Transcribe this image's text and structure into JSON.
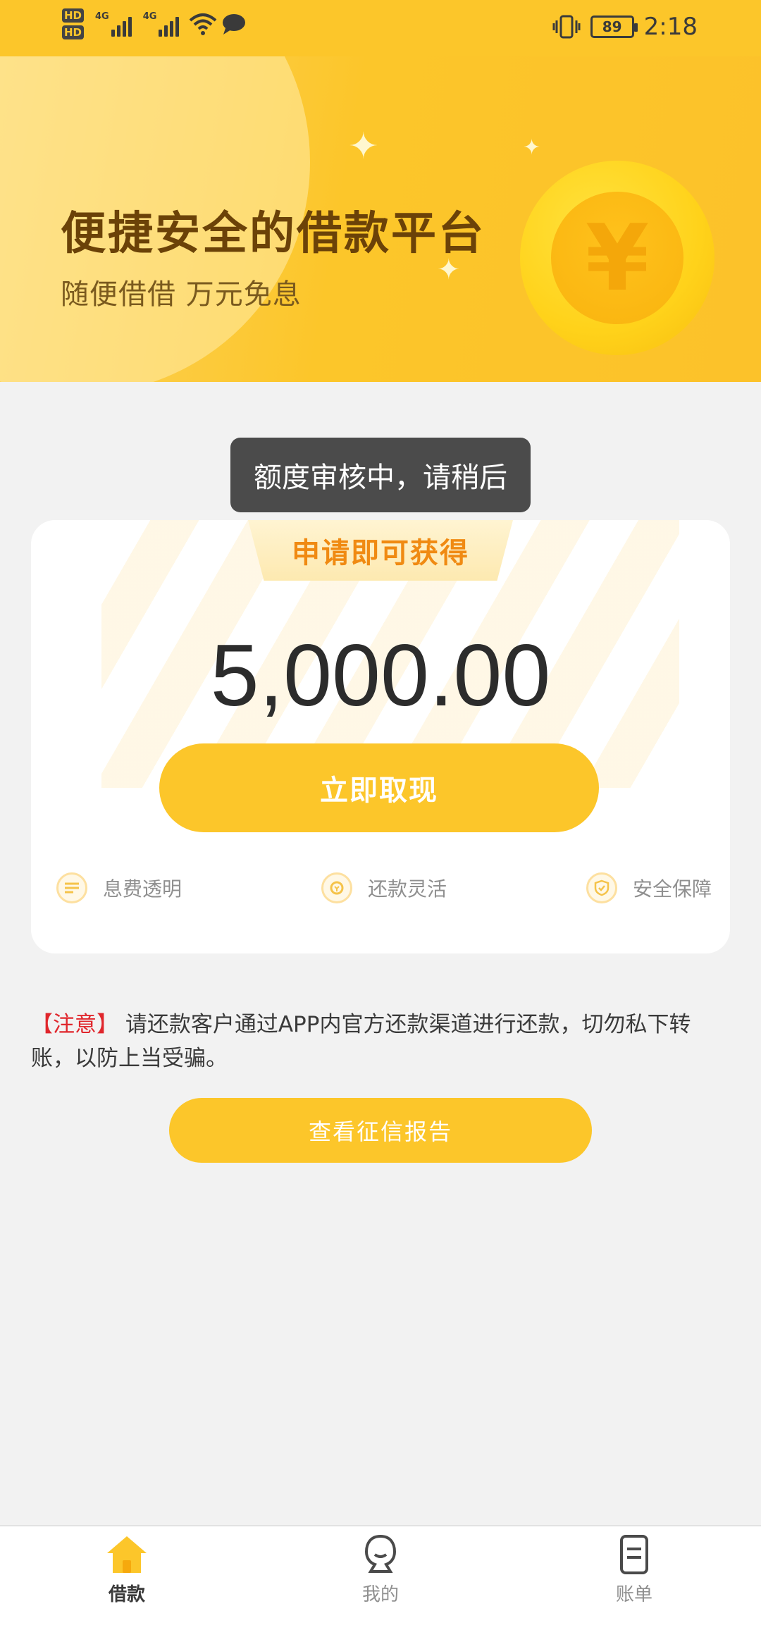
{
  "status_bar": {
    "hd1": "HD",
    "hd2": "HD",
    "sim1_label": "4G",
    "sim2_label": "4G",
    "battery": "89",
    "time": "2:18"
  },
  "banner": {
    "title": "便捷安全的借款平台",
    "subtitle": "随便借借 万元免息",
    "coin_symbol": "¥"
  },
  "toast": {
    "text": "额度审核中，请稍后"
  },
  "card": {
    "ribbon_label": "申请即可获得",
    "amount": "5,000.00",
    "withdraw_label": "立即取现",
    "features": [
      {
        "label": "息费透明",
        "icon": "receipt-icon"
      },
      {
        "label": "还款灵活",
        "icon": "repay-icon"
      },
      {
        "label": "安全保障",
        "icon": "shield-icon"
      }
    ]
  },
  "notice": {
    "tag": "【注意】",
    "text": " 请还款客户通过APP内官方还款渠道进行还款，切勿私下转账，以防上当受骗。"
  },
  "credit_report_label": "查看征信报告",
  "bottom_nav": [
    {
      "label": "借款",
      "icon": "home-icon",
      "active": true
    },
    {
      "label": "我的",
      "icon": "profile-icon",
      "active": false
    },
    {
      "label": "账单",
      "icon": "bill-icon",
      "active": false
    }
  ],
  "colors": {
    "accent": "#fcc62a",
    "notice_red": "#e0262c",
    "ribbon_text": "#f08a12"
  }
}
